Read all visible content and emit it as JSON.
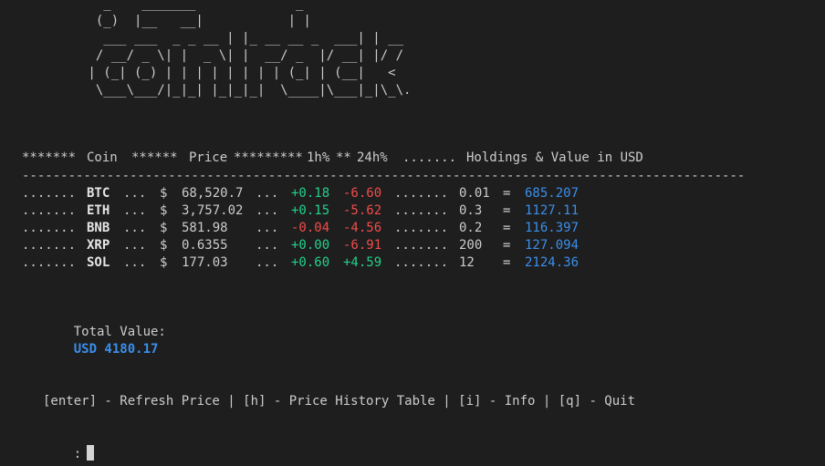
{
  "banner": "   _    _______             _\n  (_)  |__   __|           | |\n   ___ ___  _ _ __ | |_ __ __ _  ___| | __\n  / __/ _ \\| |  _ \\| |  __/ _  |/ __| |/ /\n | (_| (_) | | | | | | | | (_| | (__|   <\n  \\___\\___/|_|_| |_|_|_|  \\____|\\___|_|\\_\\.",
  "header": {
    "stars1": "*******",
    "coin": "Coin",
    "stars2": "******",
    "price": "Price",
    "stars3": "*********",
    "h1": "1h%",
    "stars4": "**",
    "h24": "24h%",
    "dots": ".......",
    "holdings": "Holdings & Value in USD"
  },
  "separator": "----------------------------------------------------------------------------------------------",
  "rows": [
    {
      "lead": ".......",
      "coin": "BTC",
      "sep1": "...",
      "cur": "$",
      "price": "68,520.7",
      "sep2": "...",
      "h1": "+0.18",
      "h1_dir": "up",
      "h24": "-6.60",
      "h24_dir": "down",
      "sep3": ".......",
      "holdings": "0.01",
      "eq": "=",
      "value": "685.207"
    },
    {
      "lead": ".......",
      "coin": "ETH",
      "sep1": "...",
      "cur": "$",
      "price": "3,757.02",
      "sep2": "...",
      "h1": "+0.15",
      "h1_dir": "up",
      "h24": "-5.62",
      "h24_dir": "down",
      "sep3": ".......",
      "holdings": "0.3",
      "eq": "=",
      "value": "1127.11"
    },
    {
      "lead": ".......",
      "coin": "BNB",
      "sep1": "...",
      "cur": "$",
      "price": "581.98",
      "sep2": "...",
      "h1": "-0.04",
      "h1_dir": "down",
      "h24": "-4.56",
      "h24_dir": "down",
      "sep3": ".......",
      "holdings": "0.2",
      "eq": "=",
      "value": "116.397"
    },
    {
      "lead": ".......",
      "coin": "XRP",
      "sep1": "...",
      "cur": "$",
      "price": "0.6355",
      "sep2": "...",
      "h1": "+0.00",
      "h1_dir": "up",
      "h24": "-6.91",
      "h24_dir": "down",
      "sep3": ".......",
      "holdings": "200",
      "eq": "=",
      "value": "127.094"
    },
    {
      "lead": ".......",
      "coin": "SOL",
      "sep1": "...",
      "cur": "$",
      "price": "177.03",
      "sep2": "...",
      "h1": "+0.60",
      "h1_dir": "up",
      "h24": "+4.59",
      "h24_dir": "up",
      "sep3": ".......",
      "holdings": "12",
      "eq": "=",
      "value": "2124.36"
    }
  ],
  "total": {
    "label": "Total Value:",
    "value": "USD 4180.17"
  },
  "menu": "[enter] - Refresh Price | [h] - Price History Table | [i] - Info | [q] - Quit",
  "prompt": ":",
  "colors": {
    "background": "#1e1e1e",
    "text": "#cccccc",
    "up": "#23d18b",
    "down": "#f14c4c",
    "value": "#3b8eea"
  }
}
